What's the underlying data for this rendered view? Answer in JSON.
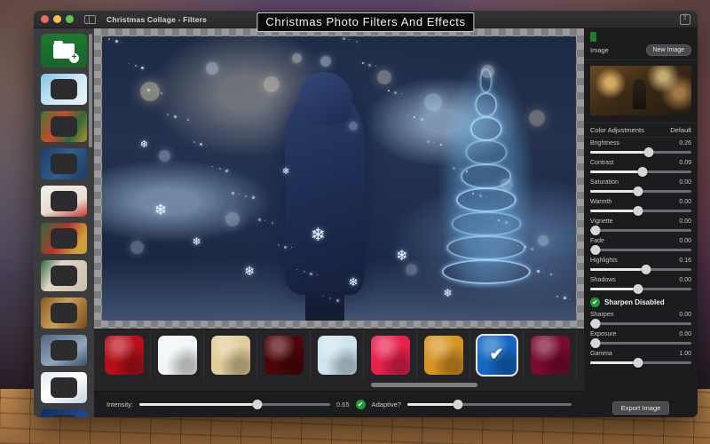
{
  "window": {
    "title": "Christmas Collage - Filters",
    "traffic_lights": [
      "close",
      "minimize",
      "zoom"
    ],
    "sidebar_toggle_icon": "sidebar-toggle-icon",
    "share_icon": "share-icon"
  },
  "banner": {
    "text": "Christmas Photo Filters And Effects"
  },
  "sidebar": {
    "add_button_icon": "add-collage-icon",
    "templates": [
      {
        "name": "template-snow-gifts"
      },
      {
        "name": "template-wreath-heart"
      },
      {
        "name": "template-blue-frame"
      },
      {
        "name": "template-merry-christmas-cards"
      },
      {
        "name": "template-santa-wreath"
      },
      {
        "name": "template-holly-border"
      },
      {
        "name": "template-gold-ornaments"
      },
      {
        "name": "template-snowman-night"
      },
      {
        "name": "template-frost-border"
      },
      {
        "name": "template-blue-santa-night"
      }
    ]
  },
  "filters": {
    "items": [
      {
        "name": "filter-crimson",
        "color": "#b5101a",
        "selected": false
      },
      {
        "name": "filter-snow-white",
        "color": "#f2f5f7",
        "selected": false
      },
      {
        "name": "filter-champagne-gold",
        "color": "#e2cd9a",
        "selected": false
      },
      {
        "name": "filter-dark-red",
        "color": "#4d0609",
        "selected": false
      },
      {
        "name": "filter-ice-blue",
        "color": "#cfe4ef",
        "selected": false
      },
      {
        "name": "filter-rose-red",
        "color": "#e8204e",
        "selected": false
      },
      {
        "name": "filter-golden-glow",
        "color": "#d89422",
        "selected": false
      },
      {
        "name": "filter-winter-blue",
        "color": "#1567c4",
        "selected": true
      },
      {
        "name": "filter-magenta-dark",
        "color": "#7a0b30",
        "selected": false
      }
    ],
    "selected_check_glyph": "✔"
  },
  "bottom_bar": {
    "intensity_label": "Intensity:",
    "intensity_value": "0.65",
    "intensity_percent": 62,
    "adaptive_label": "Adaptive?",
    "adaptive_checked": true,
    "adaptive_percent": 31,
    "check_glyph": "✔"
  },
  "right_panel": {
    "image_label": "Image",
    "new_image_button": "New Image",
    "preview_name": "image-preview",
    "adjustments_label": "Color Adjustments",
    "default_label": "Default",
    "sharpen_toggle_label": "Sharpen Disabled",
    "sharpen_toggle_checked": true,
    "check_glyph": "✔",
    "export_button": "Export Image",
    "adjustments": [
      {
        "name": "Brightness",
        "value": "0.26",
        "percent": 58
      },
      {
        "name": "Contrast",
        "value": "0.09",
        "percent": 52
      },
      {
        "name": "Saturation",
        "value": "0.00",
        "percent": 47
      },
      {
        "name": "Warmth",
        "value": "0.00",
        "percent": 47
      },
      {
        "name": "Vignette",
        "value": "0.00",
        "percent": 5
      },
      {
        "name": "Fade",
        "value": "0.00",
        "percent": 5
      },
      {
        "name": "Highlights",
        "value": "0.16",
        "percent": 55
      },
      {
        "name": "Shadows",
        "value": "0.00",
        "percent": 47
      }
    ],
    "adjustments_after_toggle": [
      {
        "name": "Sharpen",
        "value": "0.00",
        "percent": 5
      },
      {
        "name": "Exposure",
        "value": "0.00",
        "percent": 5
      },
      {
        "name": "Gamma",
        "value": "1.00",
        "percent": 47
      }
    ]
  },
  "colors": {
    "accent_green": "#1f9d34",
    "panel_bg": "#1c1c1e",
    "sidebar_bg": "#3c3c3e",
    "selection_outline": "#e9e9ec"
  }
}
